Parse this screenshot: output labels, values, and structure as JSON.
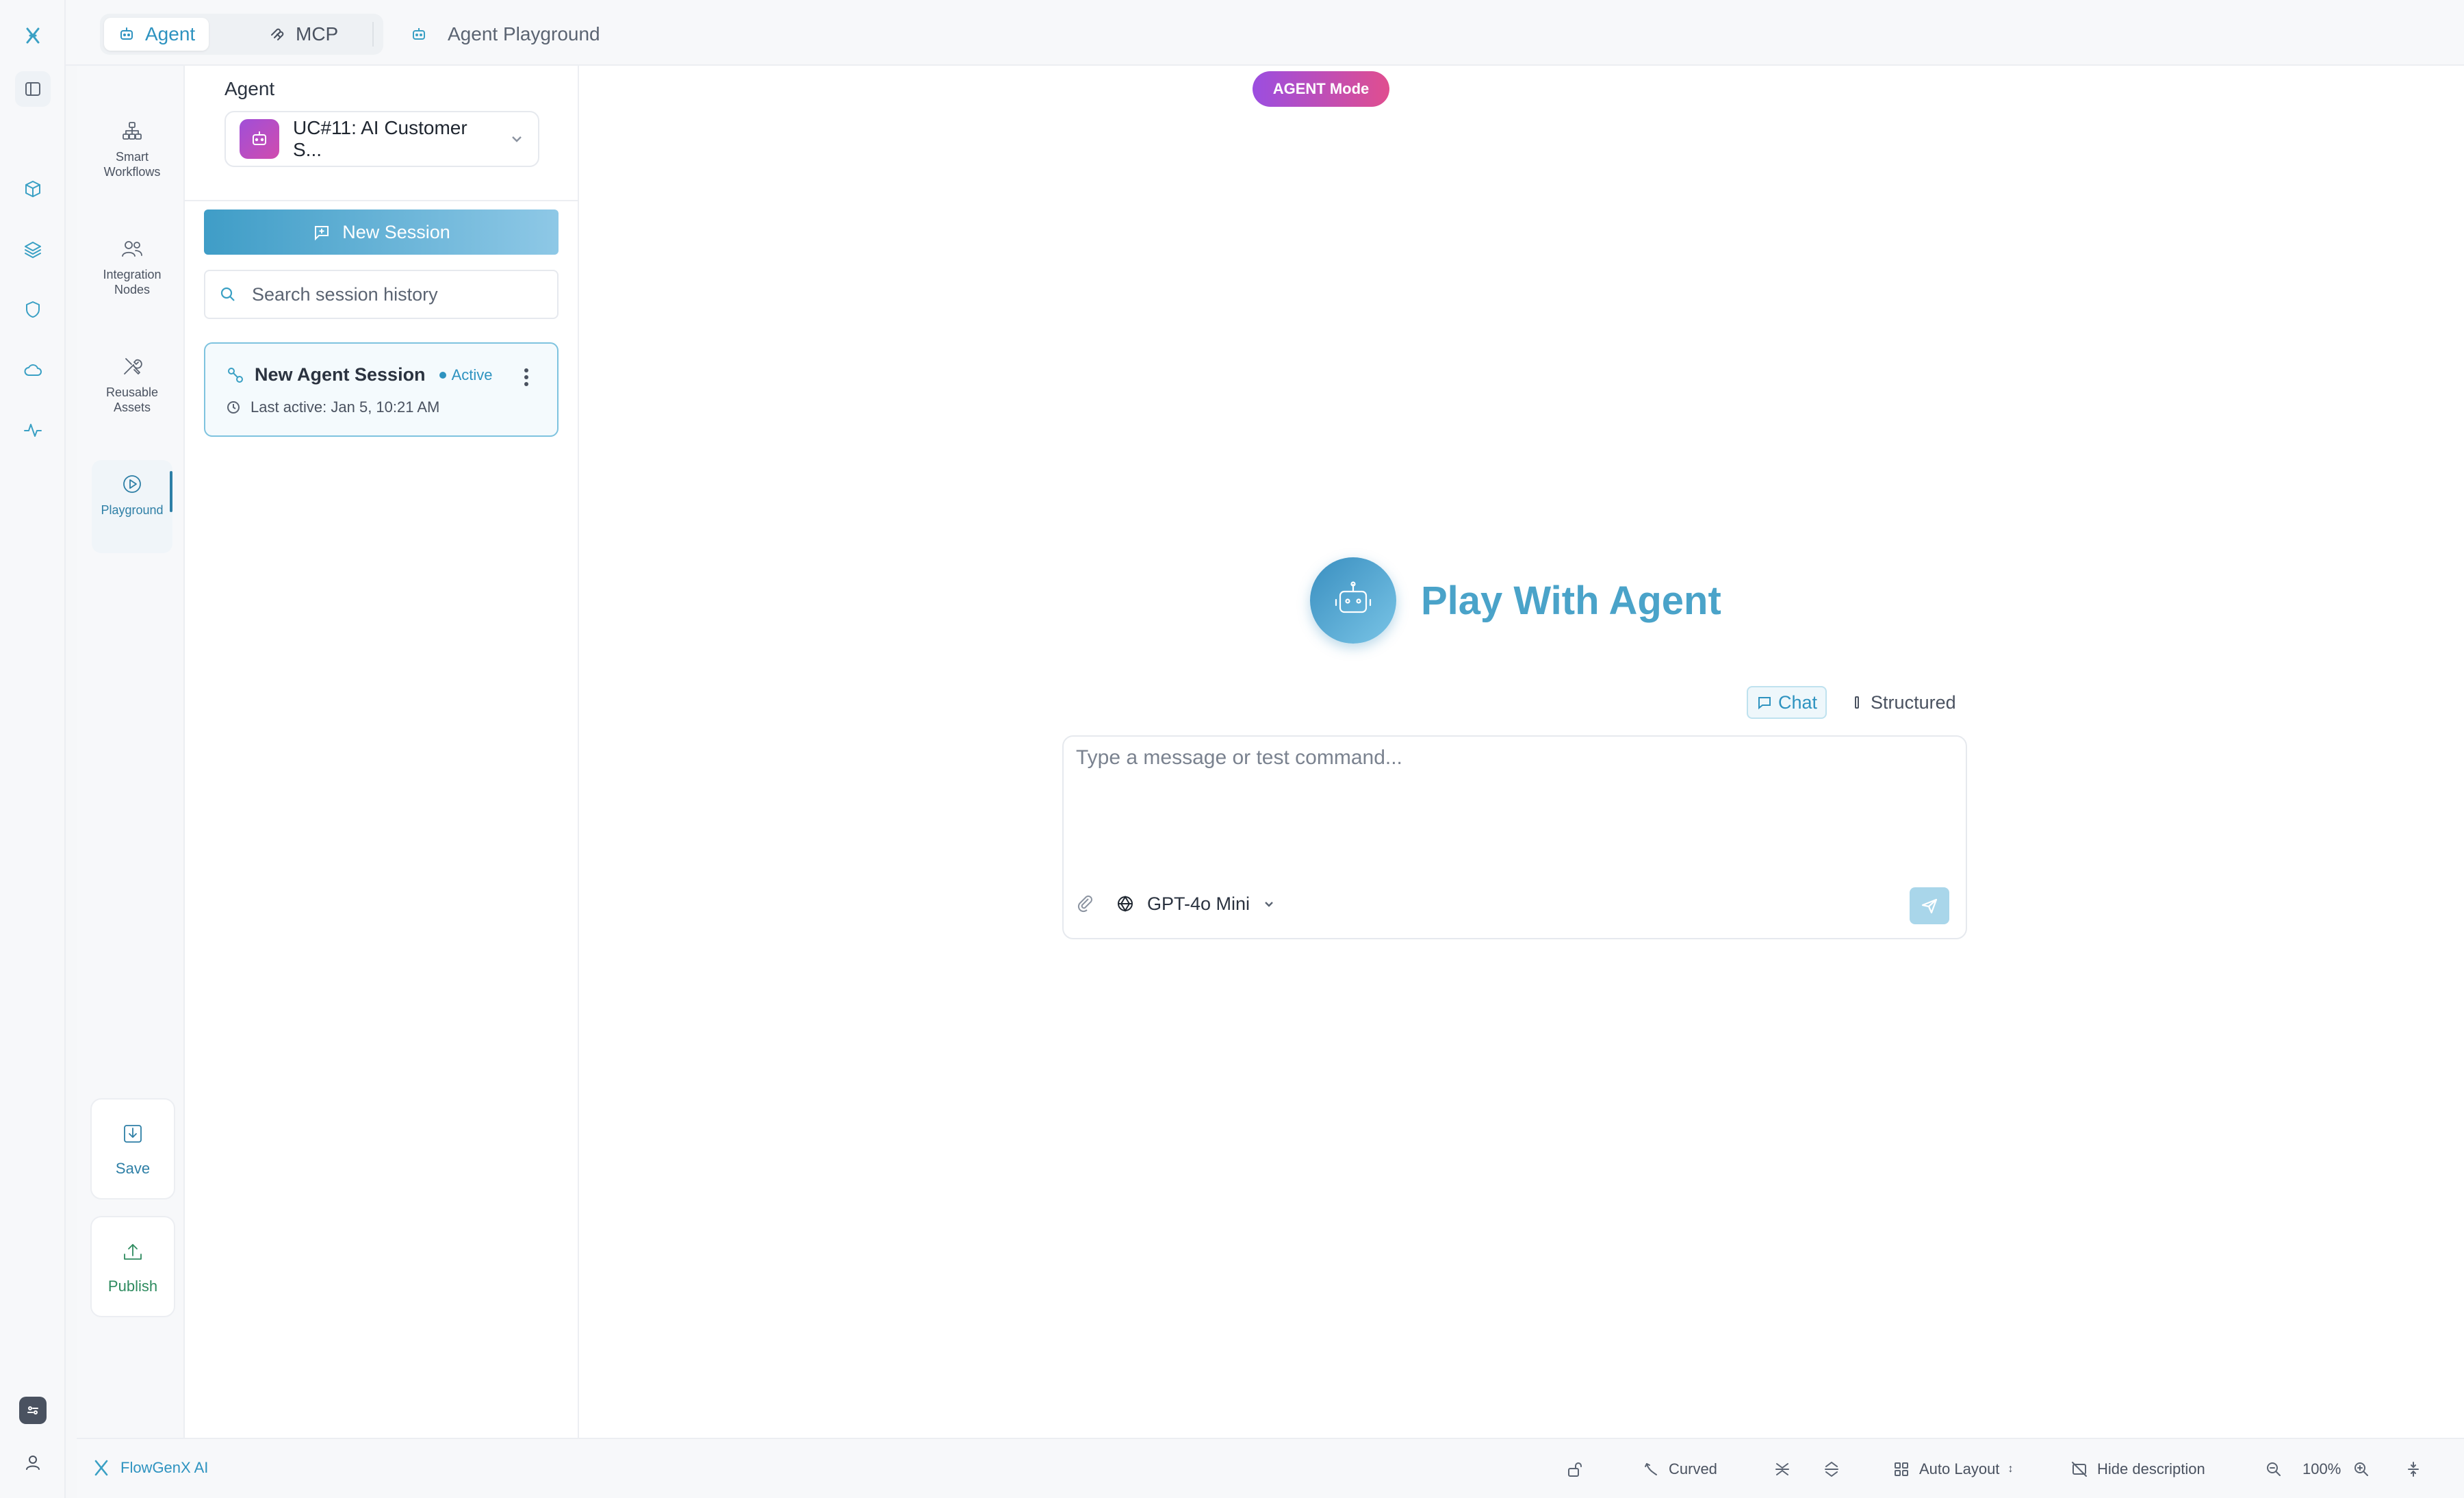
{
  "topbar": {
    "tabs": [
      {
        "label": "Agent",
        "icon": "bot-icon",
        "active": true
      },
      {
        "label": "MCP",
        "icon": "mcp-icon",
        "active": false
      }
    ],
    "breadcrumb": "Agent Playground"
  },
  "tools": {
    "items": [
      {
        "label": "Smart Workflows",
        "icon": "workflow-icon"
      },
      {
        "label": "Integration Nodes",
        "icon": "users-icon"
      },
      {
        "label": "Reusable Assets",
        "icon": "tools-icon"
      },
      {
        "label": "Playground",
        "icon": "play-icon",
        "selected": true
      }
    ],
    "save_label": "Save",
    "publish_label": "Publish"
  },
  "panel": {
    "agent_label": "Agent",
    "agent_name": "UC#11: AI Customer S...",
    "new_session_label": "New Session",
    "search_placeholder": "Search session history",
    "session": {
      "title": "New Agent Session",
      "status": "Active",
      "last_active": "Last active: Jan 5, 10:21 AM"
    }
  },
  "main": {
    "mode_badge": "AGENT Mode",
    "hero_title": "Play With Agent",
    "modes": [
      {
        "label": "Chat",
        "active": true
      },
      {
        "label": "Structured",
        "active": false
      }
    ],
    "composer_placeholder": "Type a message or test command...",
    "model_name": "GPT-4o Mini"
  },
  "statusbar": {
    "brand": "FlowGenX AI",
    "edge_style": "Curved",
    "auto_layout": "Auto Layout",
    "hide_description": "Hide description",
    "zoom": "100%"
  },
  "colors": {
    "accent": "#3aa0c4",
    "mode_badge_start": "#9b4ee0",
    "mode_badge_end": "#e04e8f"
  }
}
